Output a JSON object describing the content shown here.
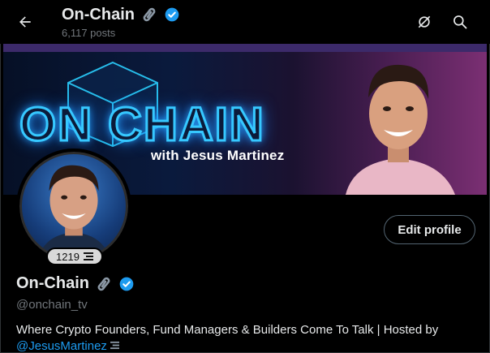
{
  "header": {
    "title": "On-Chain",
    "post_count": "6,117 posts"
  },
  "banner": {
    "title": "ON CHAIN",
    "subtitle": "with Jesus Martinez"
  },
  "profile": {
    "badge_count": "1219",
    "edit_button": "Edit profile",
    "name": "On-Chain",
    "handle": "@onchain_tv",
    "bio_text": "Where Crypto Founders, Fund Managers & Builders Come To Talk | Hosted by",
    "bio_mention": "@JesusMartinez"
  },
  "colors": {
    "background": "#000000",
    "accent": "#1d9bf0",
    "muted": "#71767b",
    "verified": "#1d9bf0"
  },
  "icons": [
    "back-arrow-icon",
    "link-icon",
    "verified-icon",
    "mute-icon",
    "search-icon",
    "stack-icon"
  ]
}
